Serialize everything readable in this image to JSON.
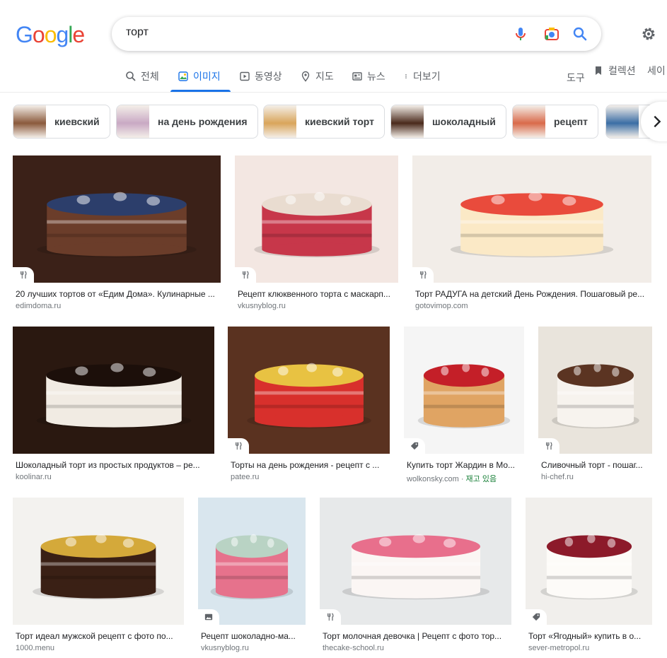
{
  "header": {
    "logo_letters": [
      {
        "ch": "G",
        "color": "#4285f4"
      },
      {
        "ch": "o",
        "color": "#ea4335"
      },
      {
        "ch": "o",
        "color": "#fbbc05"
      },
      {
        "ch": "g",
        "color": "#4285f4"
      },
      {
        "ch": "l",
        "color": "#34a853"
      },
      {
        "ch": "e",
        "color": "#ea4335"
      }
    ],
    "search_value": "торт",
    "icons": [
      "microphone-icon",
      "camera-lens-icon",
      "search-icon",
      "gear-icon"
    ]
  },
  "tabs": [
    {
      "label": "전체",
      "icon": "search-icon",
      "active": false
    },
    {
      "label": "이미지",
      "icon": "image-icon",
      "active": true
    },
    {
      "label": "동영상",
      "icon": "play-icon",
      "active": false
    },
    {
      "label": "지도",
      "icon": "map-pin-icon",
      "active": false
    },
    {
      "label": "뉴스",
      "icon": "news-icon",
      "active": false
    },
    {
      "label": "더보기",
      "icon": "more-vert-icon",
      "active": false
    }
  ],
  "tools": {
    "tools_label": "도구",
    "collections_label": "컬렉션",
    "safesearch_label": "세이"
  },
  "chips": [
    {
      "label": "киевский",
      "color": "#8b5a3c"
    },
    {
      "label": "на день рождения",
      "color": "#c9a9c4"
    },
    {
      "label": "киевский торт",
      "color": "#d9a55b"
    },
    {
      "label": "шоколадный",
      "color": "#4a2a1c"
    },
    {
      "label": "рецепт",
      "color": "#d96a4a"
    },
    {
      "label": "",
      "color": "#3b6ea5"
    }
  ],
  "results": [
    {
      "title": "20 лучших тортов от «Едим Дома». Кулинарные ...",
      "source": "edimdoma.ru",
      "badge": "fork-knife-icon",
      "c1": "#3b2118",
      "c2": "#6b3d2a",
      "c3": "#2c3e6b"
    },
    {
      "title": "Рецепт клюквенного торта с маскарп...",
      "source": "vkusnyblog.ru",
      "badge": "fork-knife-icon",
      "c1": "#f3e7e2",
      "c2": "#c7374a",
      "c3": "#e9dcd0"
    },
    {
      "title": "Торт РАДУГА на детский День Рождения. Пошаговый ре...",
      "source": "gotovimop.com",
      "badge": "fork-knife-icon",
      "c1": "#f2ede8",
      "c2": "#fbe9c6",
      "c3": "#e94b3c"
    },
    {
      "title": "Шоколадный торт из простых продуктов – ре...",
      "source": "koolinar.ru",
      "badge": "",
      "c1": "#2a1810",
      "c2": "#f1ebe3",
      "c3": "#1c0f0a"
    },
    {
      "title": "Торты на день рождения - рецепт с ...",
      "source": "patee.ru",
      "badge": "fork-knife-icon",
      "c1": "#5a3220",
      "c2": "#d8302c",
      "c3": "#e8c242"
    },
    {
      "title": "Купить торт Жардин в Мо...",
      "source": "wolkonsky.com",
      "stock": "재고 있음",
      "badge": "tag-icon",
      "c1": "#f5f5f5",
      "c2": "#e0a463",
      "c3": "#c41f28"
    },
    {
      "title": "Сливочный торт - пошаг...",
      "source": "hi-chef.ru",
      "badge": "fork-knife-icon",
      "c1": "#e9e4dc",
      "c2": "#f7f3ee",
      "c3": "#5b3422"
    },
    {
      "title": "Торт идеал мужской рецепт с фото по...",
      "source": "1000.menu",
      "badge": "",
      "c1": "#f3f2ef",
      "c2": "#3a2015",
      "c3": "#d4a93a"
    },
    {
      "title": "Рецепт шоколадно-ма...",
      "source": "vkusnyblog.ru",
      "badge": "image-icon",
      "c1": "#d9e6ee",
      "c2": "#e6728c",
      "c3": "#b9d3c4"
    },
    {
      "title": "Торт молочная девочка | Рецепт с фото тор...",
      "source": "thecake-school.ru",
      "badge": "fork-knife-icon",
      "c1": "#e7e9ea",
      "c2": "#fbf6f4",
      "c3": "#e86f8c"
    },
    {
      "title": "Торт «Ягодный» купить в о...",
      "source": "sever-metropol.ru",
      "badge": "tag-icon",
      "c1": "#f1efec",
      "c2": "#fdfbf8",
      "c3": "#8c1a2a"
    }
  ]
}
